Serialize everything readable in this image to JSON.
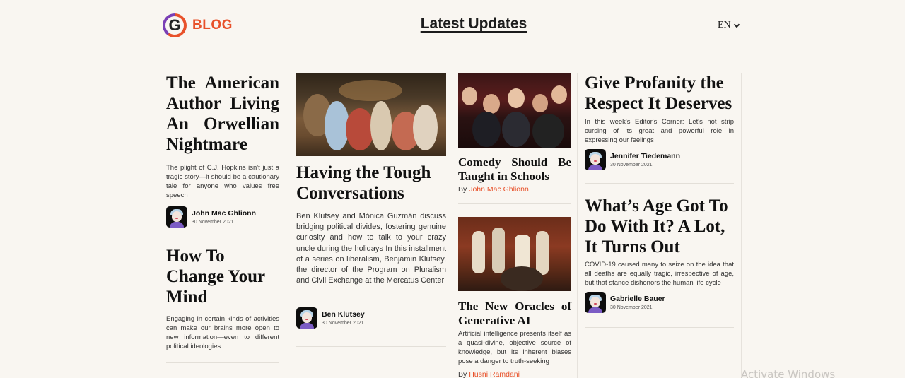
{
  "header": {
    "logo_letter": "G",
    "logo_text": "BLOG",
    "page_title": "Latest Updates",
    "language": "EN",
    "brand_color": "#e8512a"
  },
  "col1": {
    "article1": {
      "title": "The American Author Living An Orwellian Nightmare",
      "excerpt": "The plight of C.J. Hopkins isn't just a tragic story—it should be a cautionary tale for anyone who values free speech",
      "author": "John Mac Ghlionn",
      "date": "30 November 2021"
    },
    "article2": {
      "title": "How To Change Your Mind",
      "excerpt": "Engaging in certain kinds of activities can make our brains more open to new information—even to different political ideologies"
    }
  },
  "col2": {
    "article": {
      "image": "baroque-party-painting",
      "title": "Having the Tough Conversations",
      "excerpt": "Ben Klutsey and Mónica Guzmán discuss bridging political divides, fostering genuine curiosity and how to talk to your crazy uncle during the holidays In this installment of a series on liberalism, Benjamin Klutsey, the director of the Program on Pluralism and Civil Exchange at the Mercatus Center",
      "author": "Ben Klutsey",
      "date": "30 November 2021"
    }
  },
  "col3": {
    "article1": {
      "image": "laughing-audience-photo",
      "title": "Comedy Should Be Taught in Schools",
      "by_label": "By",
      "author": "John Mac Ghlionn"
    },
    "article2": {
      "image": "oracle-temple-painting",
      "title": "The New Oracles of Generative AI",
      "excerpt": "Artificial intelligence presents itself as a quasi-divine, objective source of knowledge, but its inherent biases pose a danger to truth-seeking",
      "by_label": "By",
      "author": "Husni Ramdani"
    }
  },
  "col4": {
    "article1": {
      "title": "Give Profanity the Respect It Deserves",
      "excerpt": "In this week's Editor's Corner: Let's not strip cursing of its great and powerful role in expressing our feelings",
      "author": "Jennifer Tiedemann",
      "date": "30 November 2021"
    },
    "article2": {
      "title": "What’s Age Got To Do With It? A Lot, It Turns Out",
      "excerpt": "COVID-19 caused many to seize on the idea that all deaths are equally tragic, irrespective of age, but that stance dishonors the human life cycle",
      "author": "Gabrielle Bauer",
      "date": "30 November 2021"
    }
  },
  "watermark": "Activate Windows"
}
